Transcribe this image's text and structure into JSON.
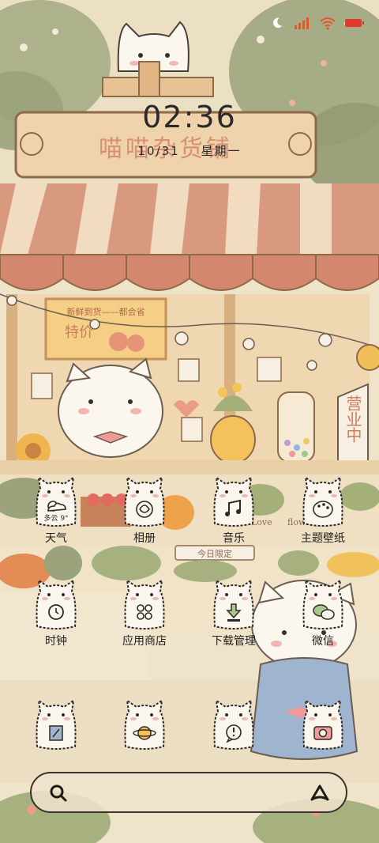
{
  "status_bar": {
    "icons": [
      "moon-icon",
      "signal-icon",
      "wifi-icon",
      "battery-icon"
    ],
    "battery_color": "#e23a2a",
    "signal_color": "#e2582a"
  },
  "lockscreen": {
    "time": "02:36",
    "date": "10/31",
    "weekday": "星期一"
  },
  "wallpaper": {
    "shop_sign": "喵喵杂货铺",
    "board_text_1": "新鲜到货——都会省",
    "board_text_2": "特价",
    "side_sign": "营业中",
    "small_sign": "今日限定",
    "love_text": "Love",
    "flower_text": "flowe"
  },
  "apps": [
    {
      "label": "天气",
      "icon": "weather-icon",
      "weather": "多云 9°"
    },
    {
      "label": "相册",
      "icon": "gallery-icon"
    },
    {
      "label": "音乐",
      "icon": "music-icon"
    },
    {
      "label": "主题壁纸",
      "icon": "palette-icon"
    },
    {
      "label": "时钟",
      "icon": "alarm-clock-icon"
    },
    {
      "label": "应用商店",
      "icon": "app-store-icon"
    },
    {
      "label": "下载管理",
      "icon": "download-icon"
    },
    {
      "label": "微信",
      "icon": "wechat-icon"
    }
  ],
  "dock": [
    {
      "icon": "notes-icon"
    },
    {
      "icon": "browser-icon"
    },
    {
      "icon": "messages-icon"
    },
    {
      "icon": "camera-icon"
    }
  ],
  "search_bar": {
    "left_icon": "search-icon",
    "right_icon": "assistant-icon"
  }
}
